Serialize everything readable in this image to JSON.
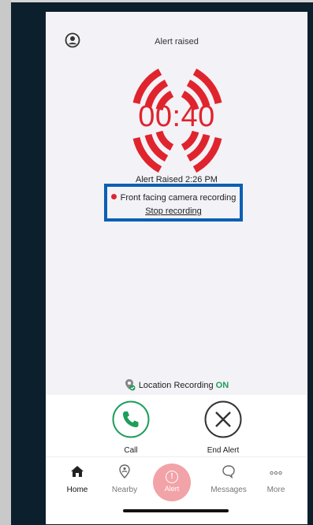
{
  "header": {
    "title": "Alert raised"
  },
  "alarm": {
    "timer": "00:40",
    "raised_text": "Alert Raised 2:26 PM"
  },
  "recording": {
    "status": "Front facing camera recording",
    "stop_label": "Stop recording"
  },
  "location": {
    "label": "Location Recording",
    "status": "ON"
  },
  "actions": {
    "call_label": "Call",
    "end_label": "End Alert"
  },
  "tabs": {
    "home": "Home",
    "nearby": "Nearby",
    "alert": "Alert",
    "messages": "Messages",
    "more": "More"
  },
  "colors": {
    "alert_red": "#e0242d",
    "highlight_blue": "#0a5fb4",
    "success_green": "#1e9e5a",
    "alert_tab_pink": "#f2a3a8"
  }
}
